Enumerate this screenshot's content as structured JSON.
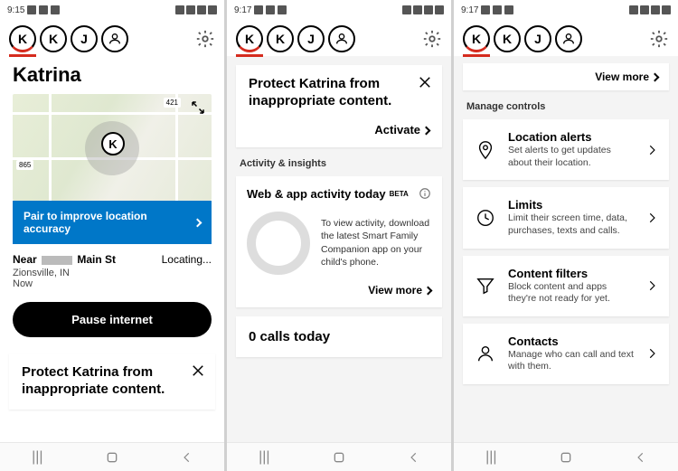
{
  "screens": [
    {
      "statusbar": {
        "time": "9:15"
      },
      "avatars": [
        "K",
        "K",
        "J"
      ],
      "profileName": "Katrina",
      "map": {
        "pinLetter": "K",
        "shield1": "421",
        "shield2": "865"
      },
      "blueBar": "Pair to improve location accuracy",
      "location": {
        "nearPrefix": "Near",
        "nearSuffix": "Main St",
        "status": "Locating...",
        "city": "Zionsville, IN",
        "time": "Now"
      },
      "pauseButton": "Pause internet",
      "protectCard": {
        "title": "Protect Katrina from inappropriate content."
      }
    },
    {
      "statusbar": {
        "time": "9:17"
      },
      "avatars": [
        "K",
        "K",
        "J"
      ],
      "protectCard": {
        "title": "Protect Katrina from inappropriate content.",
        "action": "Activate"
      },
      "sectionLabel": "Activity & insights",
      "activity": {
        "title": "Web & app activity today",
        "badge": "BETA",
        "text": "To view activity, download the latest Smart Family Companion app on your child's phone.",
        "viewMore": "View more"
      },
      "callsCard": "0 calls today"
    },
    {
      "statusbar": {
        "time": "9:17"
      },
      "avatars": [
        "K",
        "K",
        "J"
      ],
      "topViewMore": "View more",
      "sectionLabel": "Manage controls",
      "controls": [
        {
          "icon": "location-pin-icon",
          "title": "Location alerts",
          "desc": "Set alerts to get updates about their location."
        },
        {
          "icon": "clock-icon",
          "title": "Limits",
          "desc": "Limit their screen time, data, purchases, texts and calls."
        },
        {
          "icon": "filter-icon",
          "title": "Content filters",
          "desc": "Block content and apps they're not ready for yet."
        },
        {
          "icon": "person-icon",
          "title": "Contacts",
          "desc": "Manage who can call and text with them."
        }
      ]
    }
  ]
}
